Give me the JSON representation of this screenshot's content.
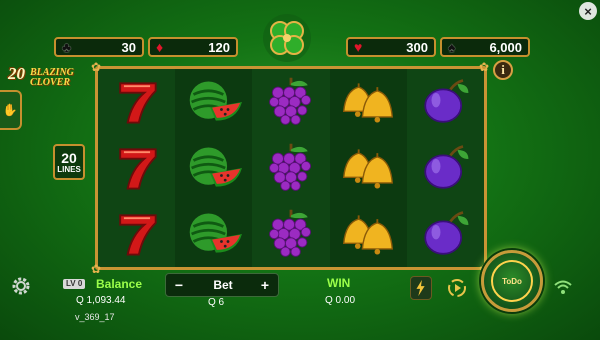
{
  "counters": {
    "clubs": "30",
    "diamonds": "120",
    "hearts": "300",
    "spades": "6,000"
  },
  "logo": {
    "number": "20",
    "word1": "BLAZING",
    "word2": "CLOVER"
  },
  "info_label": "i",
  "lines": {
    "count": "20",
    "label": "LINES"
  },
  "reels": [
    [
      "seven",
      "seven",
      "seven"
    ],
    [
      "watermelon",
      "watermelon",
      "watermelon"
    ],
    [
      "grapes",
      "grapes",
      "grapes"
    ],
    [
      "bells",
      "bells",
      "bells"
    ],
    [
      "plum",
      "plum",
      "plum"
    ]
  ],
  "bottom": {
    "level_badge": "LV 0",
    "balance_label": "Balance",
    "balance_value": "Q 1,093.44",
    "version": "v_369_17",
    "bet_minus": "−",
    "bet_label": "Bet",
    "bet_plus": "+",
    "bet_value": "Q 6",
    "win_label": "WIN",
    "win_value": "Q 0.00",
    "spin_label": "ToDo"
  },
  "close_label": "×",
  "colors": {
    "frame_gold": "#c99434",
    "accent_green": "#9bff4a",
    "felt_green": "#137214"
  }
}
